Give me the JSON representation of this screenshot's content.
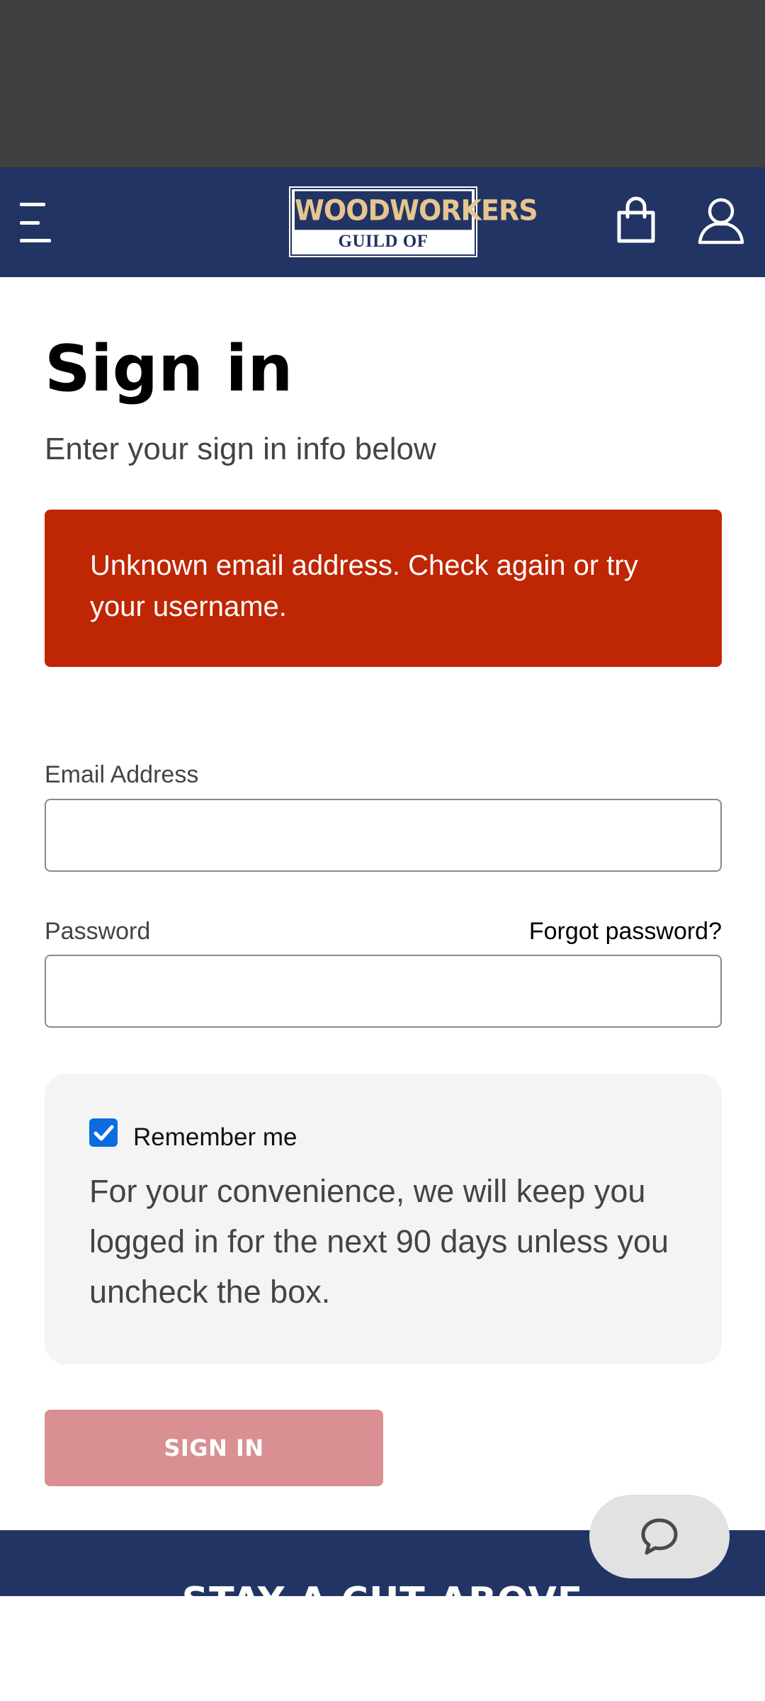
{
  "header": {
    "logo_line1": "WOODWORKERS",
    "logo_line2": "GUILD OF AMERICA",
    "menu_icon": "hamburger-menu-icon",
    "cart_icon": "shopping-bag-icon",
    "account_icon": "user-icon"
  },
  "page": {
    "title": "Sign in",
    "subtitle": "Enter your sign in info below"
  },
  "error": {
    "message": "Unknown email address. Check again or try your username."
  },
  "form": {
    "email_label": "Email Address",
    "email_value": "",
    "password_label": "Password",
    "password_value": "",
    "forgot_link": "Forgot password?",
    "remember_label": "Remember me",
    "remember_checked": true,
    "remember_help": "For your convenience, we will keep you logged in for the next 90 days unless you uncheck the box.",
    "submit_label": "SIGN IN"
  },
  "footer": {
    "heading": "STAY A CUT ABOVE"
  },
  "chat": {
    "icon": "chat-bubble-icon"
  },
  "colors": {
    "header_bg": "#223463",
    "error_bg": "#bf2604",
    "button_bg": "#d99092",
    "checkbox": "#0b6ce0"
  }
}
